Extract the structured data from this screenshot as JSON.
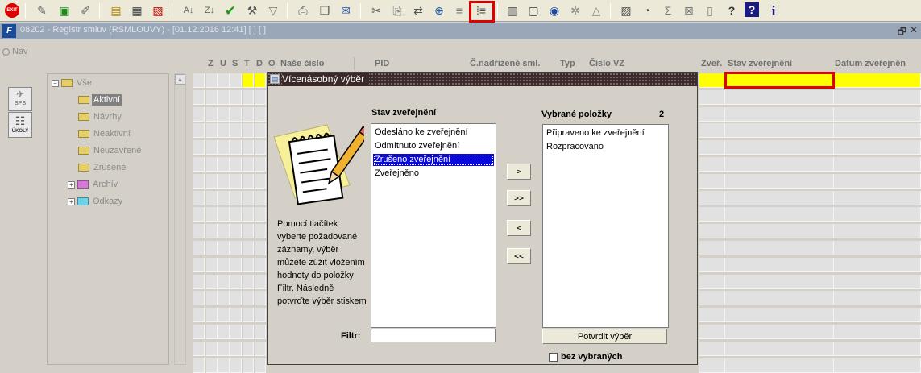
{
  "toolbar": {
    "icons": [
      "exit-icon",
      "insert-record-icon",
      "save-icon",
      "delete-record-icon",
      "query-icon",
      "query-execute-icon",
      "query-cancel-icon",
      "sort-asc-icon",
      "sort-desc-icon",
      "check-icon",
      "wrench-icon",
      "filter-icon",
      "print-icon",
      "copy-icon",
      "mail-icon",
      "cut-icon",
      "paste-icon",
      "transfer-icon",
      "zoom-icon",
      "list-icon",
      "multi-select-icon",
      "calendar-icon",
      "doc-icon",
      "globe-icon",
      "gear-icon",
      "triangle-icon",
      "chart-icon",
      "clock-icon",
      "sum-icon",
      "close-box-icon",
      "notes-icon",
      "help-user-icon",
      "help-icon",
      "info-icon"
    ],
    "exit_label": "EXIT"
  },
  "window": {
    "title": "08202 - Registr smluv (RSMLOUVY) - [01.12.2016  12:41]  [  ]  [  ]",
    "restore_glyph": "🗗",
    "close_glyph": "✕"
  },
  "left": {
    "nav_label": "Nav",
    "sps_label": "SPS",
    "ukoly_label": "ÚKOLY"
  },
  "tree": {
    "root": "Vše",
    "items": [
      "Aktivní",
      "Návrhy",
      "Neaktivní",
      "Neuzavřené",
      "Zrušené",
      "Archív",
      "Odkazy"
    ]
  },
  "grid": {
    "flags": [
      "Z",
      "U",
      "S",
      "T",
      "D",
      "O"
    ],
    "headers": {
      "nase_cislo": "Naše číslo",
      "pid": "PID",
      "c_nadrizene": "Č.nadřízené sml.",
      "typ": "Typ",
      "cislo_vz": "Číslo VZ",
      "zver": "Zveř.",
      "stav_zverejneni": "Stav zveřejnění",
      "datum_zverejneni": "Datum zveřejněn"
    }
  },
  "dialog": {
    "title": "Vícenásobný výběr",
    "source_label": "Stav zveřejnění",
    "source_items": [
      "Odesláno ke zveřejnění",
      "Odmítnuto zveřejnění",
      "Zrušeno zveřejnění",
      "Zveřejněno"
    ],
    "selected_source_index": 2,
    "target_label": "Vybrané položky",
    "target_count": "2",
    "target_items": [
      "Připraveno ke zveřejnění",
      "Rozpracováno"
    ],
    "buttons": {
      "add": ">",
      "add_all": ">>",
      "remove": "<",
      "remove_all": "<<"
    },
    "help_text": "Pomocí tlačítek vyberte požadované záznamy, výběr můžete zúžit vložením hodnoty do položky Filtr. Následně potvrďte výběr stiskem",
    "filter_label": "Filtr:",
    "filter_value": "",
    "confirm_label": "Potvrdit výběr",
    "without_selected_label": "bez vybraných"
  },
  "colors": {
    "highlight_row": "#ffff00",
    "selection": "#0a0adc",
    "annotation_red": "#e00000"
  }
}
